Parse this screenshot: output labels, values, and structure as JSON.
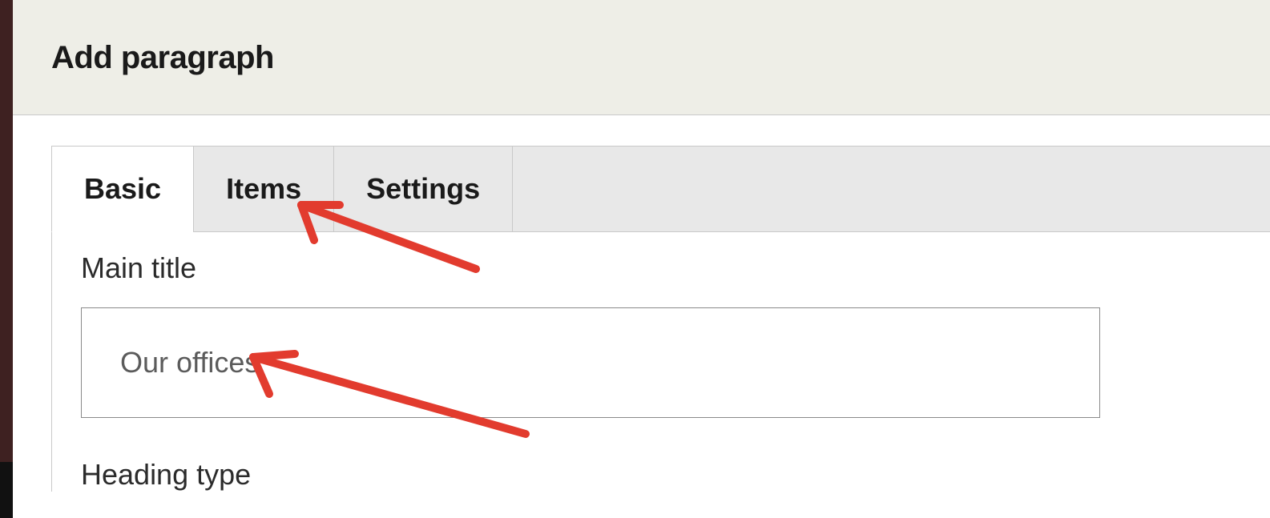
{
  "header": {
    "title": "Add paragraph"
  },
  "tabs": [
    {
      "label": "Basic",
      "active": true
    },
    {
      "label": "Items",
      "active": false
    },
    {
      "label": "Settings",
      "active": false
    }
  ],
  "fields": {
    "main_title": {
      "label": "Main title",
      "value": "Our offices"
    },
    "heading_type": {
      "label": "Heading type"
    }
  },
  "annotations": {
    "arrow_color": "#e23b2e"
  }
}
